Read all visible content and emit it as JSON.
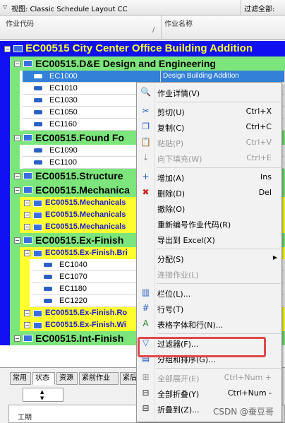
{
  "toolbar": {
    "view_label": "视图: Classic Schedule Layout CC",
    "filter_label": "过滤全部:"
  },
  "columns": {
    "code": "作业代码",
    "name": "作业名称"
  },
  "rows": [
    {
      "text": "EC00515  City Center Office Building Addition",
      "level": 0
    },
    {
      "text": "EC00515.D&E  Design and Engineering",
      "level": 1
    },
    {
      "text": "EC1000",
      "level": "a1",
      "selected": true,
      "name": "Design Building Addition"
    },
    {
      "text": "EC1010",
      "level": "a1"
    },
    {
      "text": "EC1030",
      "level": "a1"
    },
    {
      "text": "EC1050",
      "level": "a1"
    },
    {
      "text": "EC1160",
      "level": "a1"
    },
    {
      "text": "EC00515.Found  Fo",
      "level": 1
    },
    {
      "text": "EC1090",
      "level": "a1"
    },
    {
      "text": "EC1100",
      "level": "a1"
    },
    {
      "text": "EC00515.Structure",
      "level": 1
    },
    {
      "text": "EC00515.Mechanica",
      "level": 1
    },
    {
      "text": "EC00515.Mechanicals",
      "level": 2
    },
    {
      "text": "EC00515.Mechanicals",
      "level": 2
    },
    {
      "text": "EC00515.Mechanicals",
      "level": 2
    },
    {
      "text": "EC00515.Ex-Finish",
      "level": 1
    },
    {
      "text": "EC00515.Ex-Finish.Bri",
      "level": 2
    },
    {
      "text": "EC1040",
      "level": "a2"
    },
    {
      "text": "EC1070",
      "level": "a2"
    },
    {
      "text": "EC1180",
      "level": "a2"
    },
    {
      "text": "EC1220",
      "level": "a2"
    },
    {
      "text": "EC00515.Ex-Finish.Ro",
      "level": 2
    },
    {
      "text": "EC00515.Ex-Finish.Wi",
      "level": 2
    },
    {
      "text": "EC00515.Int-Finish",
      "level": 1
    }
  ],
  "bottom_tabs": [
    "常用",
    "状态",
    "资源",
    "紧前作业",
    "紧后"
  ],
  "bottom_panel_label": "工期",
  "menu": [
    {
      "label": "作业详情(V)",
      "shortcut": "",
      "icon": "activity-details-icon",
      "glyph": "🔍",
      "disabled": false
    },
    {
      "sep": true
    },
    {
      "label": "剪切(U)",
      "shortcut": "Ctrl+X",
      "icon": "scissors-icon",
      "glyph": "✂",
      "disabled": false
    },
    {
      "label": "复制(C)",
      "shortcut": "Ctrl+C",
      "icon": "copy-icon",
      "glyph": "❐",
      "disabled": false
    },
    {
      "label": "粘贴(P)",
      "shortcut": "Ctrl+V",
      "icon": "paste-icon",
      "glyph": "📋",
      "disabled": true
    },
    {
      "label": "向下填充(W)",
      "shortcut": "Ctrl+E",
      "icon": "fill-down-icon",
      "glyph": "⇣",
      "disabled": true
    },
    {
      "sep": true
    },
    {
      "label": "增加(A)",
      "shortcut": "Ins",
      "icon": "add-icon",
      "glyph": "+",
      "disabled": false
    },
    {
      "label": "删除(D)",
      "shortcut": "Del",
      "icon": "delete-icon",
      "glyph": "✖",
      "disabled": false
    },
    {
      "label": "撤除(O)",
      "shortcut": "",
      "icon": "",
      "glyph": "",
      "disabled": false
    },
    {
      "label": "重新编号作业代码(R)",
      "shortcut": "",
      "icon": "",
      "glyph": "",
      "disabled": false
    },
    {
      "label": "导出到 Excel(X)",
      "shortcut": "",
      "icon": "",
      "glyph": "",
      "disabled": false
    },
    {
      "sep": true
    },
    {
      "label": "分配(S)",
      "shortcut": "",
      "icon": "",
      "glyph": "",
      "disabled": false,
      "submenu": true
    },
    {
      "label": "连接作业(L)",
      "shortcut": "",
      "icon": "",
      "glyph": "",
      "disabled": true
    },
    {
      "sep": true
    },
    {
      "label": "栏位(L)...",
      "shortcut": "",
      "icon": "columns-icon",
      "glyph": "▥",
      "disabled": false
    },
    {
      "label": "行号(T)",
      "shortcut": "",
      "icon": "row-number-icon",
      "glyph": "#",
      "disabled": false
    },
    {
      "label": "表格字体和行(N)...",
      "shortcut": "",
      "icon": "table-font-icon",
      "glyph": "A",
      "disabled": false
    },
    {
      "sep": true
    },
    {
      "label": "过滤器(F)...",
      "shortcut": "",
      "icon": "filter-icon",
      "glyph": "▽",
      "disabled": false
    },
    {
      "label": "分组和排序(G)...",
      "shortcut": "",
      "icon": "group-sort-icon",
      "glyph": "▤",
      "disabled": false
    },
    {
      "sep": true
    },
    {
      "label": "全部展开(E)",
      "shortcut": "Ctrl+Num +",
      "icon": "expand-all-icon",
      "glyph": "⊞",
      "disabled": true
    },
    {
      "label": "全部折叠(Y)",
      "shortcut": "Ctrl+Num -",
      "icon": "collapse-all-icon",
      "glyph": "⊟",
      "disabled": false
    },
    {
      "label": "折叠到(Z)...",
      "shortcut": "",
      "icon": "collapse-to-icon",
      "glyph": "⊟",
      "disabled": false
    }
  ],
  "watermark": "CSDN @蚕豆哥",
  "colors": {
    "wbs0": "#1010f0",
    "wbs1": "#7ce67c",
    "wbs2": "#ffff30",
    "selected": "#3380d8",
    "highlight": "#e04848"
  }
}
